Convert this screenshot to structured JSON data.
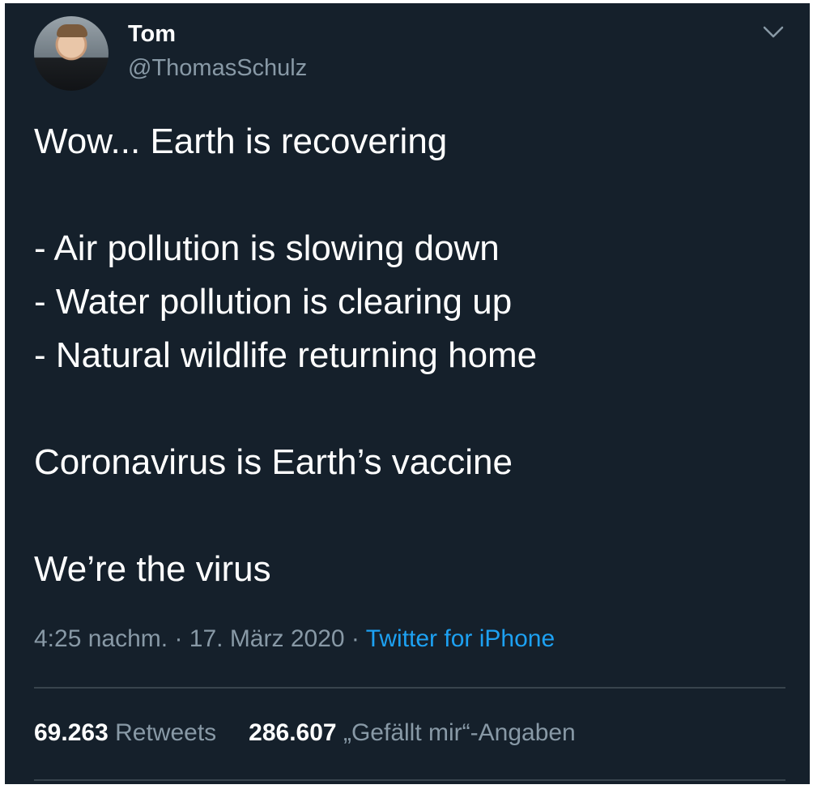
{
  "author": {
    "name": "Tom",
    "handle": "@ThomasSchulz",
    "avatar_icon": "profile-photo"
  },
  "tweet": {
    "lines": [
      "Wow... Earth is recovering",
      "",
      "- Air pollution is slowing down",
      "- Water pollution is clearing up",
      "- Natural wildlife returning home",
      "",
      "Coronavirus is Earth’s vaccine",
      "",
      "We’re the virus"
    ]
  },
  "meta": {
    "time": "4:25 nachm.",
    "separator": " · ",
    "date": "17. März 2020",
    "source": "Twitter for iPhone"
  },
  "stats": {
    "retweets_count": "69.263",
    "retweets_label": "Retweets",
    "likes_count": "286.607",
    "likes_label": "„Gefällt mir“-Angaben"
  },
  "colors": {
    "background": "#15202b",
    "text": "#ffffff",
    "secondary": "#8899a6",
    "link": "#1da1f2",
    "divider": "#38444d"
  }
}
